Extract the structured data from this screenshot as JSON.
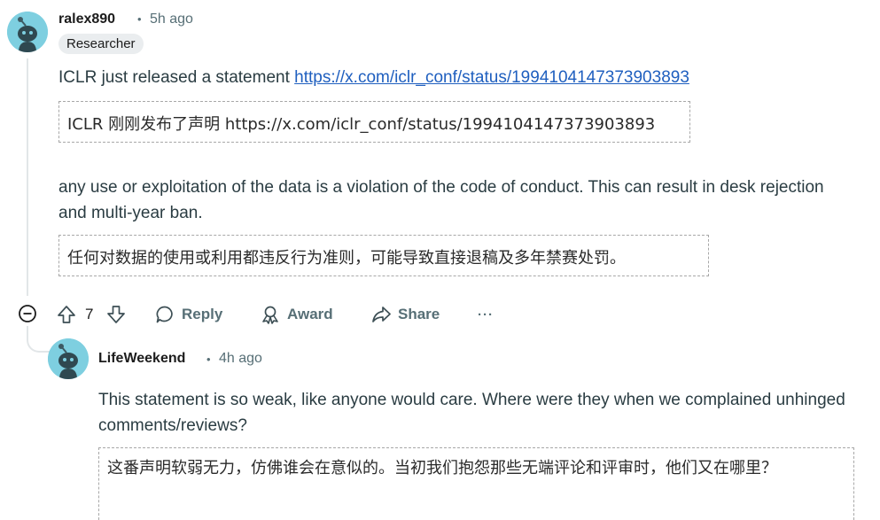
{
  "comment": {
    "username": "ralex890",
    "separator": "•",
    "time": "5h ago",
    "flair": "Researcher",
    "text_prefix": "ICLR just released a statement ",
    "link": "https://x.com/iclr_conf/status/1994104147373903893",
    "translation_1": "ICLR 刚刚发布了声明 https://x.com/iclr_conf/status/1994104147373903893",
    "text_2": "any use or exploitation of the data is a violation of the code of conduct. This can result in desk rejection and multi-year ban.",
    "translation_2": "任何对数据的使用或利用都违反行为准则，可能导致直接退稿及多年禁赛处罚。",
    "actions": {
      "vote_count": "7",
      "reply_label": "Reply",
      "award_label": "Award",
      "share_label": "Share",
      "more_label": "···"
    }
  },
  "reply": {
    "username": "LifeWeekend",
    "separator": "•",
    "time": "4h ago",
    "text": "This statement is so weak, like anyone would care. Where were they when we complained unhinged comments/reviews?",
    "translation": "这番声明软弱无力，仿佛谁会在意似的。当初我们抱怨那些无端评论和评审时，他们又在哪里？"
  },
  "colors": {
    "avatar_bg": "#7ecfe0",
    "link": "#1f5fbf",
    "meta": "#576f76"
  }
}
